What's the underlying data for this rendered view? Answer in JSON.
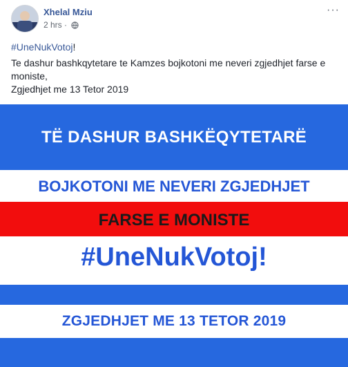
{
  "post": {
    "author": "Xhelal Mziu",
    "time": "2 hrs",
    "dot": "·",
    "privacy_icon": "globe-icon",
    "more_icon": "more-options-icon",
    "more_glyph": "···",
    "hashtag": "#UneNukVotoj",
    "hashtag_suffix": "!",
    "text_line1": "Te dashur bashkqytetare te Kamzes bojkotoni me neveri zgjedhjet farse e moniste,",
    "text_line2": "Zgjedhjet me 13 Tetor 2019"
  },
  "poster": {
    "line1": "TË DASHUR BASHKËQYTETARË",
    "line2": "BOJKOTONI ME NEVERI ZGJEDHJET",
    "line3": "FARSE E MONISTE",
    "line4": "#UneNukVotoj!",
    "line5": "ZGJEDHJET ME 13 TETOR 2019",
    "colors": {
      "blue": "#2668df",
      "red": "#f20d0d",
      "white": "#ffffff",
      "text_blue": "#2456d6"
    }
  }
}
